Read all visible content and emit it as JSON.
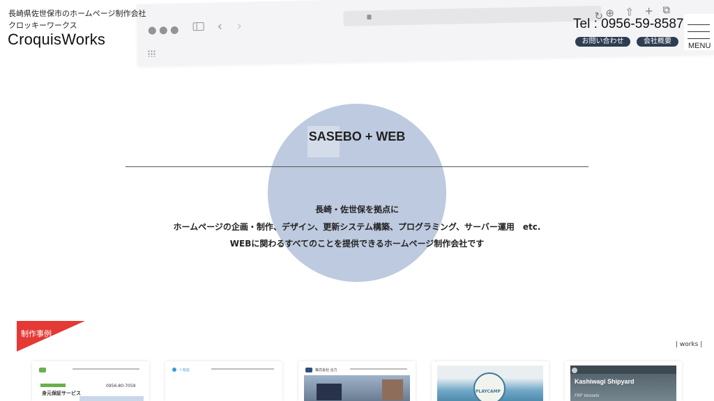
{
  "header": {
    "tagline": "長崎県佐世保市のホームページ制作会社",
    "kana_name": "クロッキーワークス",
    "logo": "CroquisWorks",
    "tel": "Tel : 0956-59-8587",
    "contact_label": "お問い合わせ",
    "company_label": "会社概要",
    "menu_label": "MENU"
  },
  "hero": {
    "title": "SASEBO + WEB",
    "lines": [
      "長崎・佐世保を拠点に",
      "ホームページの企画・制作、デザイン、更新システム構築、プログラミング、サーバー運用　etc.",
      "WEBに関わるすべてのことを提供できるホームページ制作会社です"
    ]
  },
  "works": {
    "tag_label": "制作事例",
    "link_label": "| works |",
    "thumbnails": [
      {
        "name": "身元保証サービス",
        "phone": "0956-80-7059",
        "accent": "#6ab04c"
      },
      {
        "name": "ト松店",
        "accent": "#3a9ad9"
      },
      {
        "name": "株式会社 合力",
        "accent": "#2c4f7c"
      },
      {
        "name": "PLAYCAMP",
        "accent": "#6fa8c8"
      },
      {
        "name": "Kashiwagi Shipyard",
        "sub": "FRP Vessels",
        "accent": "#4c5a63"
      }
    ]
  },
  "browser_icons": [
    "traffic-dot-icon",
    "sidebar-icon",
    "chevron-left-icon",
    "chevron-right-icon",
    "lock-icon",
    "reload-icon",
    "download-icon",
    "share-icon",
    "plus-icon",
    "tabs-icon",
    "grid-icon"
  ],
  "colors": {
    "circle": "#bdcadf",
    "pill": "#2e3e52",
    "works_tag": "#e53935"
  }
}
